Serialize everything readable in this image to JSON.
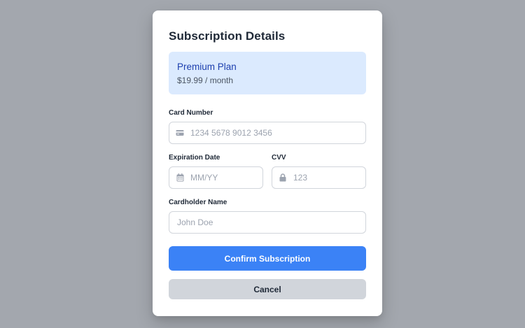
{
  "modal": {
    "title": "Subscription Details",
    "plan": {
      "name": "Premium Plan",
      "price": "$19.99 / month"
    },
    "fields": {
      "card_number": {
        "label": "Card Number",
        "placeholder": "1234 5678 9012 3456",
        "value": "",
        "icon": "credit-card-icon"
      },
      "expiration": {
        "label": "Expiration Date",
        "placeholder": "MM/YY",
        "value": "",
        "icon": "calendar-icon"
      },
      "cvv": {
        "label": "CVV",
        "placeholder": "123",
        "value": "",
        "icon": "lock-icon"
      },
      "cardholder": {
        "label": "Cardholder Name",
        "placeholder": "John Doe",
        "value": ""
      }
    },
    "buttons": {
      "confirm": "Confirm Subscription",
      "cancel": "Cancel"
    }
  },
  "colors": {
    "backdrop": "#a3a7ae",
    "accent": "#3b82f6",
    "plan_bg": "#dbeafe",
    "plan_text": "#1e40af",
    "secondary_button": "#d1d5db"
  }
}
